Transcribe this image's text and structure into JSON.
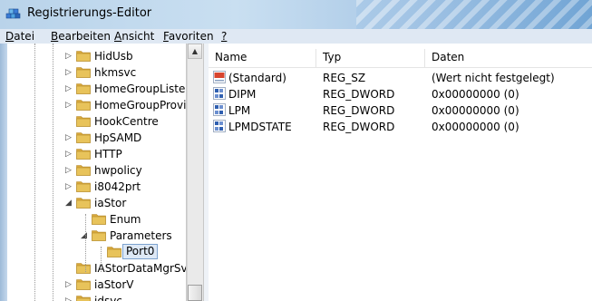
{
  "window": {
    "title": "Registrierungs-Editor"
  },
  "menu": [
    {
      "label": "Datei",
      "accel": "D",
      "rest": "atei"
    },
    {
      "label": "Bearbeiten",
      "accel": "B",
      "rest": "earbeiten"
    },
    {
      "label": "Ansicht",
      "accel": "A",
      "rest": "nsicht"
    },
    {
      "label": "Favoriten",
      "accel": "F",
      "rest": "avoriten"
    },
    {
      "label": "?",
      "accel": "?",
      "rest": ""
    }
  ],
  "tree": {
    "items": [
      {
        "label": "HidUsb",
        "expander": "collapsed"
      },
      {
        "label": "hkmsvc",
        "expander": "collapsed"
      },
      {
        "label": "HomeGroupListen",
        "expander": "collapsed"
      },
      {
        "label": "HomeGroupProvic",
        "expander": "collapsed"
      },
      {
        "label": "HookCentre",
        "expander": "none"
      },
      {
        "label": "HpSAMD",
        "expander": "collapsed"
      },
      {
        "label": "HTTP",
        "expander": "collapsed"
      },
      {
        "label": "hwpolicy",
        "expander": "collapsed"
      },
      {
        "label": "i8042prt",
        "expander": "collapsed"
      },
      {
        "label": "iaStor",
        "expander": "expanded"
      },
      {
        "label": "Enum",
        "expander": "none"
      },
      {
        "label": "Parameters",
        "expander": "expanded"
      },
      {
        "label": "Port0",
        "expander": "none",
        "selected": true
      },
      {
        "label": "IAStorDataMgrSvc",
        "expander": "none"
      },
      {
        "label": "iaStorV",
        "expander": "collapsed"
      },
      {
        "label": "idsvc",
        "expander": "collapsed"
      }
    ]
  },
  "list": {
    "columns": [
      "Name",
      "Typ",
      "Daten"
    ],
    "rows": [
      {
        "icon": "string-value-icon",
        "name": "(Standard)",
        "type": "REG_SZ",
        "data": "(Wert nicht festgelegt)"
      },
      {
        "icon": "binary-value-icon",
        "name": "DIPM",
        "type": "REG_DWORD",
        "data": "0x00000000 (0)"
      },
      {
        "icon": "binary-value-icon",
        "name": "LPM",
        "type": "REG_DWORD",
        "data": "0x00000000 (0)"
      },
      {
        "icon": "binary-value-icon",
        "name": "LPMDSTATE",
        "type": "REG_DWORD",
        "data": "0x00000000 (0)"
      }
    ]
  },
  "colors": {
    "folder": "#e8c35a",
    "selection": "#dde8f6",
    "selection_border": "#7da2ce"
  }
}
